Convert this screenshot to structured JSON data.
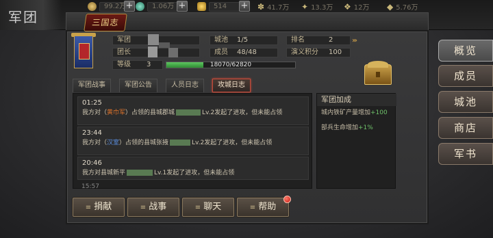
{
  "header": {
    "title": "军团"
  },
  "resources": {
    "copper": "99.2万",
    "jade": "1.06万",
    "gold": "514",
    "food": "41.7万",
    "wood": "13.3万",
    "stone": "12万",
    "iron": "5.76万"
  },
  "icons": {
    "copper": "coin-icon",
    "jade": "jade-icon",
    "gold": "gold-ingot-icon",
    "food": "wheat-icon",
    "wood": "wood-icon",
    "stone": "stone-icon",
    "iron": "iron-icon"
  },
  "colors": {
    "accent_red": "#c44a3a",
    "xp_green": "#5ec660",
    "highlight_orange": "#d8702a",
    "highlight_blue": "#5a8ee0",
    "bonus_green": "#6fc26a"
  },
  "logo_text": "三国志",
  "legion": {
    "name_label": "军团",
    "leader_label": "团长",
    "level_label": "等级",
    "level_value": "3",
    "exp_current": 18070,
    "exp_max": 62820,
    "exp_text": "18070/62820",
    "cities_label": "城池",
    "cities_value": "1/5",
    "members_label": "成员",
    "members_value": "48/48",
    "rank_label": "排名",
    "rank_value": "2",
    "points_label": "演义积分",
    "points_value": "100"
  },
  "tabs": [
    {
      "label": "军团战事"
    },
    {
      "label": "军团公告"
    },
    {
      "label": "人员日志"
    },
    {
      "label": "攻城日志"
    }
  ],
  "active_tab": "攻城日志",
  "logs": [
    {
      "time": "01:25",
      "prefix": "我方对（",
      "faction": "黄巾军",
      "middle": "）占领的县城郡城",
      "suffix": "Lv.2发起了进攻，但未能占领"
    },
    {
      "time": "23:44",
      "prefix": "我方对（",
      "faction": "汉室",
      "middle": "）占领的县城张掖",
      "suffix": "Lv.2发起了进攻，但未能占领"
    },
    {
      "time": "20:46",
      "prefix": "我方对县城新平",
      "suffix": "Lv.1发起了进攻，但未能占领"
    }
  ],
  "log_tail": "15:57",
  "bonus": {
    "title": "军团加成",
    "line1_text": "城内铁矿产量增加",
    "line1_value": "+100",
    "line2_text": "部兵生命增加",
    "line2_value": "+1%"
  },
  "bottom_buttons": [
    {
      "label": "捐献"
    },
    {
      "label": "战事"
    },
    {
      "label": "聊天"
    },
    {
      "label": "帮助"
    }
  ],
  "right_nav": [
    {
      "label": "概览"
    },
    {
      "label": "成员"
    },
    {
      "label": "城池"
    },
    {
      "label": "商店"
    },
    {
      "label": "军书"
    }
  ]
}
